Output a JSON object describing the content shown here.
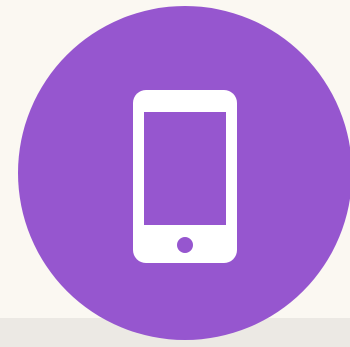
{
  "icon": {
    "name": "smartphone-icon",
    "background_color": "#9656cf",
    "foreground_color": "#ffffff"
  },
  "page": {
    "background_color": "#fbf8f2"
  }
}
